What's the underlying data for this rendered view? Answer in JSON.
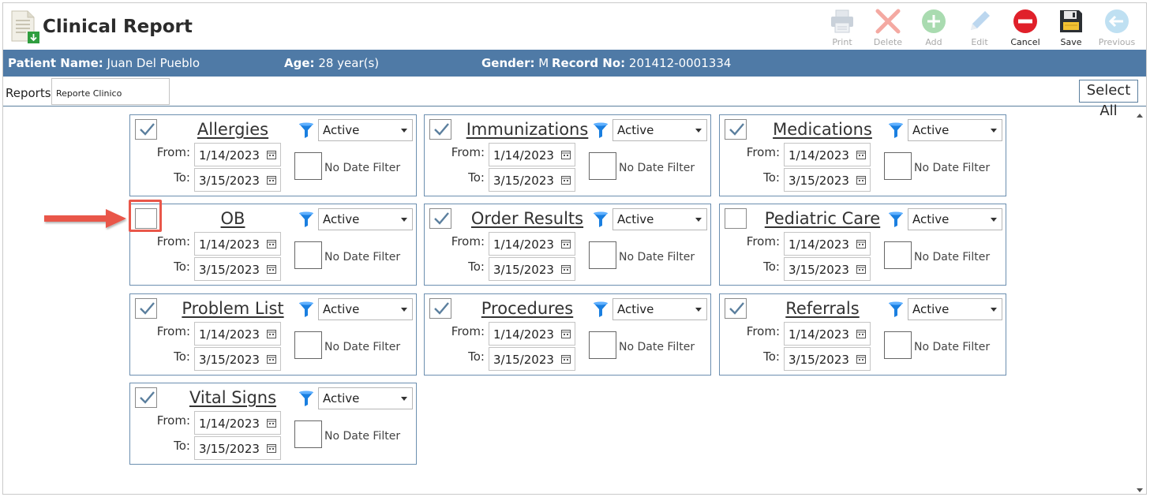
{
  "app": {
    "title": "Clinical Report",
    "icon": "document-download-icon"
  },
  "toolbar": [
    {
      "id": "print",
      "label": "Print",
      "icon": "printer-icon",
      "enabled": false
    },
    {
      "id": "delete",
      "label": "Delete",
      "icon": "delete-x-icon",
      "enabled": false
    },
    {
      "id": "add",
      "label": "Add",
      "icon": "add-circle-icon",
      "enabled": false
    },
    {
      "id": "edit",
      "label": "Edit",
      "icon": "pencil-icon",
      "enabled": false
    },
    {
      "id": "cancel",
      "label": "Cancel",
      "icon": "cancel-icon",
      "enabled": true
    },
    {
      "id": "save",
      "label": "Save",
      "icon": "floppy-disk-icon",
      "enabled": true
    },
    {
      "id": "previous",
      "label": "Previous",
      "icon": "back-arrow-icon",
      "enabled": false
    }
  ],
  "patient": {
    "name_label": "Patient Name:",
    "name": "Juan Del Pueblo",
    "age_label": "Age:",
    "age": "28 year(s)",
    "gender_label": "Gender:",
    "gender": "M",
    "record_label": "Record No:",
    "record": "201412-0001334"
  },
  "reports": {
    "label": "Reports:",
    "value": "Reporte Clinico",
    "select_all": "Select All"
  },
  "common": {
    "from_label": "From:",
    "to_label": "To:",
    "no_date_filter": "No Date Filter"
  },
  "cards": [
    {
      "title": "Allergies",
      "checked": true,
      "status": "Active",
      "from": "1/14/2023",
      "to": "3/15/2023"
    },
    {
      "title": "Immunizations",
      "checked": true,
      "status": "Active",
      "from": "1/14/2023",
      "to": "3/15/2023"
    },
    {
      "title": "Medications",
      "checked": true,
      "status": "Active",
      "from": "1/14/2023",
      "to": "3/15/2023"
    },
    {
      "title": "OB",
      "checked": false,
      "status": "Active",
      "from": "1/14/2023",
      "to": "3/15/2023"
    },
    {
      "title": "Order Results",
      "checked": true,
      "status": "Active",
      "from": "1/14/2023",
      "to": "3/15/2023"
    },
    {
      "title": "Pediatric Care",
      "checked": false,
      "status": "Active",
      "from": "1/14/2023",
      "to": "3/15/2023"
    },
    {
      "title": "Problem List",
      "checked": true,
      "status": "Active",
      "from": "1/14/2023",
      "to": "3/15/2023"
    },
    {
      "title": "Procedures",
      "checked": true,
      "status": "Active",
      "from": "1/14/2023",
      "to": "3/15/2023"
    },
    {
      "title": "Referrals",
      "checked": true,
      "status": "Active",
      "from": "1/14/2023",
      "to": "3/15/2023"
    },
    {
      "title": "Vital Signs",
      "checked": true,
      "status": "Active",
      "from": "1/14/2023",
      "to": "3/15/2023"
    }
  ],
  "colors": {
    "header_bar": "#4f7aa6",
    "card_border": "#6c8fb0",
    "check": "#5b7f9e",
    "filter": "#1a7fe0",
    "annotation": "#e9574a"
  }
}
